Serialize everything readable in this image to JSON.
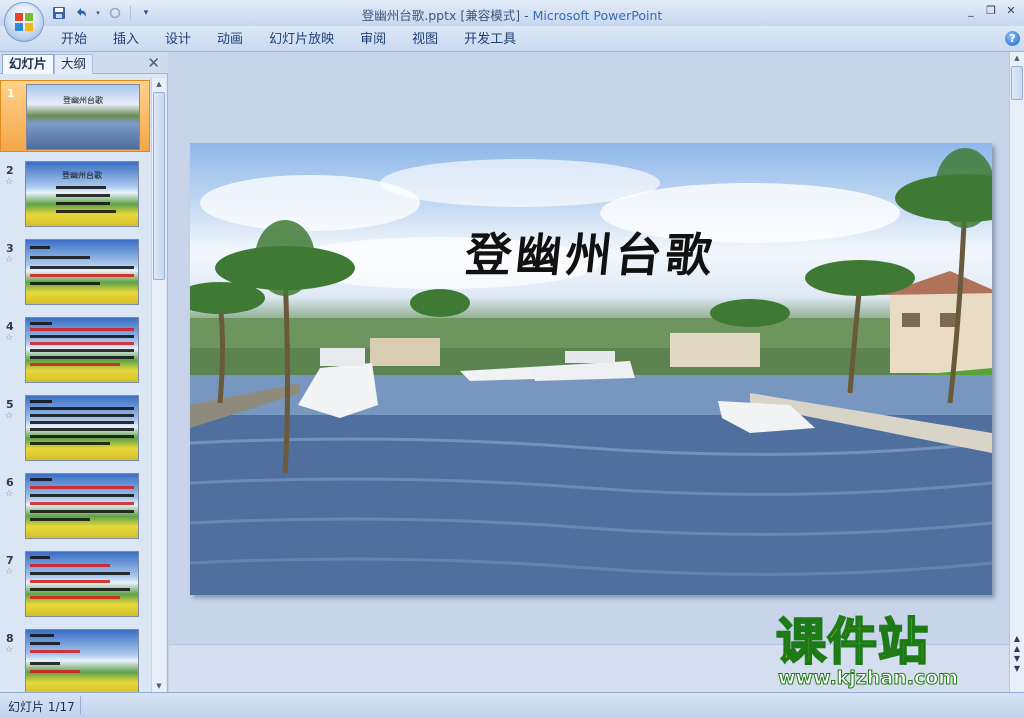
{
  "window": {
    "document_title": "登幽州台歌.pptx [兼容模式]",
    "separator": " - ",
    "app_name": "Microsoft PowerPoint",
    "controls": {
      "minimize": "_",
      "restore": "❐",
      "close": "✕"
    }
  },
  "quick_access": {
    "save_icon": "save-icon",
    "undo_icon": "undo-icon",
    "redo_icon": "redo-icon",
    "customize_icon": "customize-icon"
  },
  "ribbon": {
    "tabs": [
      {
        "label": "开始"
      },
      {
        "label": "插入"
      },
      {
        "label": "设计"
      },
      {
        "label": "动画"
      },
      {
        "label": "幻灯片放映"
      },
      {
        "label": "审阅"
      },
      {
        "label": "视图"
      },
      {
        "label": "开发工具"
      }
    ],
    "help_label": "?"
  },
  "left_pane": {
    "tab_slides": "幻灯片",
    "tab_outline": "大纲",
    "close_label": "✕",
    "thumbnails": [
      {
        "number": "1",
        "selected": true,
        "title": "登幽州台歌"
      },
      {
        "number": "2",
        "selected": false,
        "title": "登幽州台歌"
      },
      {
        "number": "3",
        "selected": false,
        "title": ""
      },
      {
        "number": "4",
        "selected": false,
        "title": ""
      },
      {
        "number": "5",
        "selected": false,
        "title": ""
      },
      {
        "number": "6",
        "selected": false,
        "title": ""
      },
      {
        "number": "7",
        "selected": false,
        "title": ""
      },
      {
        "number": "8",
        "selected": false,
        "title": ""
      }
    ],
    "star_glyph": "☆"
  },
  "slide": {
    "title": "登幽州台歌"
  },
  "watermark": {
    "main": "课件站",
    "url": "www.kjzhan.com"
  },
  "status_bar": {
    "slide_indicator": "幻灯片 1/17"
  },
  "colors": {
    "accent_selected": "#f5a64a",
    "app_name": "#3a6cb0",
    "watermark_fill": "#f6e10c",
    "watermark_stroke": "#1d7a17"
  }
}
